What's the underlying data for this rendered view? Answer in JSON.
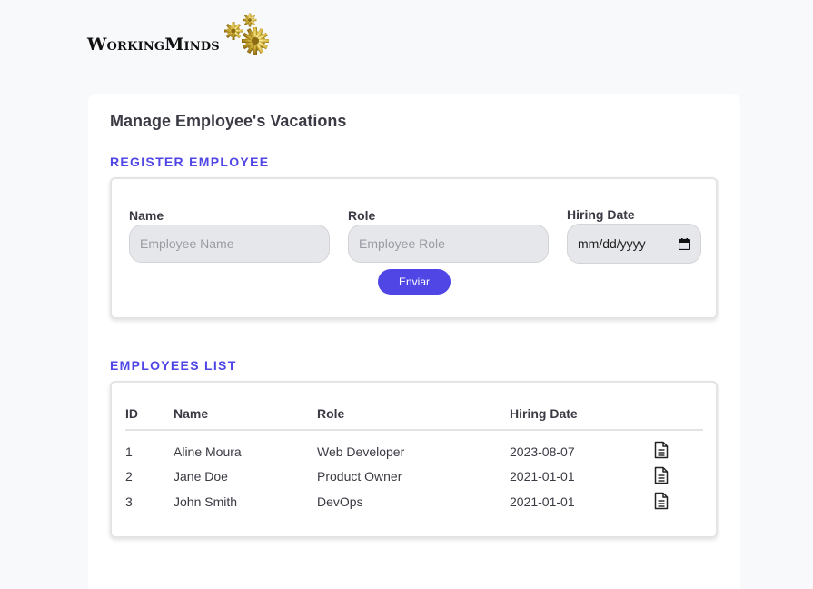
{
  "logo": {
    "text": "WorkingMinds"
  },
  "page": {
    "title": "Manage Employee's Vacations"
  },
  "register": {
    "section_title": "REGISTER EMPLOYEE",
    "name_label": "Name",
    "name_placeholder": "Employee Name",
    "role_label": "Role",
    "role_placeholder": "Employee Role",
    "hiring_label": "Hiring Date",
    "hiring_placeholder": "mm/dd/yyyy",
    "submit_label": "Enviar"
  },
  "employees": {
    "section_title": "EMPLOYEES LIST",
    "columns": [
      "ID",
      "Name",
      "Role",
      "Hiring Date"
    ],
    "rows": [
      {
        "id": "1",
        "name": "Aline Moura",
        "role": "Web Developer",
        "hiring_date": "2023-08-07",
        "action_icon": "document-icon"
      },
      {
        "id": "2",
        "name": "Jane Doe",
        "role": "Product Owner",
        "hiring_date": "2021-01-01",
        "action_icon": "document-icon"
      },
      {
        "id": "3",
        "name": "John Smith",
        "role": "DevOps",
        "hiring_date": "2021-01-01",
        "action_icon": "document-icon"
      }
    ]
  },
  "colors": {
    "accent": "#4f46e5",
    "background": "#f8f9fb",
    "input_bg": "#e6e7eb"
  }
}
